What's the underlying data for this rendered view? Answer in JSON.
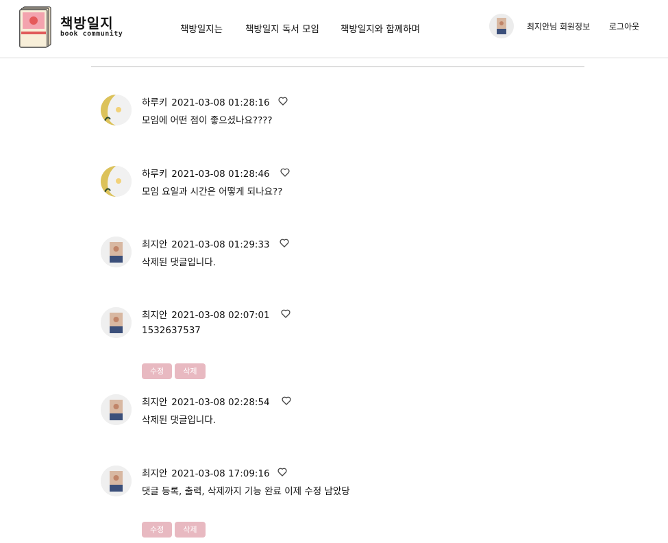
{
  "header": {
    "logo": {
      "title": "책방일지",
      "subtitle": "book community"
    },
    "nav": [
      {
        "label": "책방일지는"
      },
      {
        "label": "책방일지 독서 모임"
      },
      {
        "label": "책방일지와 함께하며"
      }
    ],
    "user_info_label": "최지안님 회원정보",
    "logout_label": "로그아웃"
  },
  "comments": [
    {
      "author": "하루키",
      "date": "2021-03-08 01:28:16",
      "text": "모임에 어떤 점이 좋으셨나요????",
      "avatar": "yellow-plant-avatar"
    },
    {
      "author": "하루키",
      "date": "2021-03-08 01:28:46",
      "text": "모임 요일과 시간은 어떻게 되나요??",
      "avatar": "yellow-plant-avatar"
    },
    {
      "author": "최지안",
      "date": "2021-03-08 01:29:33",
      "text": "삭제된 댓글입니다.",
      "avatar": "book-cover-avatar"
    },
    {
      "author": "최지안",
      "date": "2021-03-08 02:07:01",
      "text": "1532637537",
      "avatar": "book-cover-avatar",
      "buttons": {
        "edit": "수정",
        "delete": "삭제"
      }
    },
    {
      "author": "최지안",
      "date": "2021-03-08 02:28:54",
      "text": "삭제된 댓글입니다.",
      "avatar": "book-cover-avatar"
    },
    {
      "author": "최지안",
      "date": "2021-03-08 17:09:16",
      "text": "댓글 등록, 출력, 삭제까지 기능 완료 이제 수정 남았당",
      "avatar": "book-cover-avatar",
      "buttons": {
        "edit": "수정",
        "delete": "삭제"
      }
    }
  ],
  "colors": {
    "button_bg": "#e8b9c1",
    "avatar_yellow": "#dcc25a",
    "divider": "#bdbdbd"
  }
}
